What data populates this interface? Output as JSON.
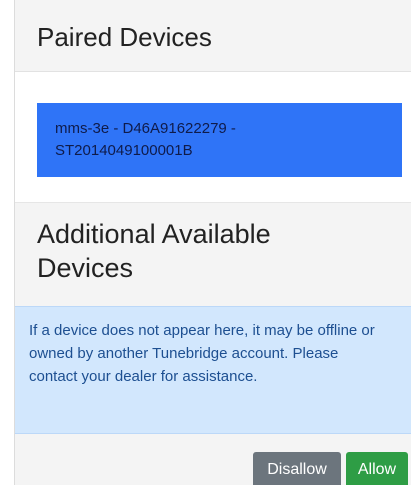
{
  "paired": {
    "title": "Paired Devices",
    "device_line1": "mms-3e - D46A91622279 -",
    "device_line2": "ST2014049100001B"
  },
  "available": {
    "title": "Additional Available Devices",
    "notice": "If a device does not appear here, it may be offline or owned by another Tunebridge account. Please contact your dealer for assistance."
  },
  "actions": {
    "disallow_label": "Disallow",
    "allow_label": "Allow"
  },
  "colors": {
    "selected_device": "#2f74f7",
    "info_background": "#d2e7fd",
    "info_text": "#1d4f91",
    "disallow_button": "#6c757d",
    "allow_button": "#2e9d45"
  }
}
